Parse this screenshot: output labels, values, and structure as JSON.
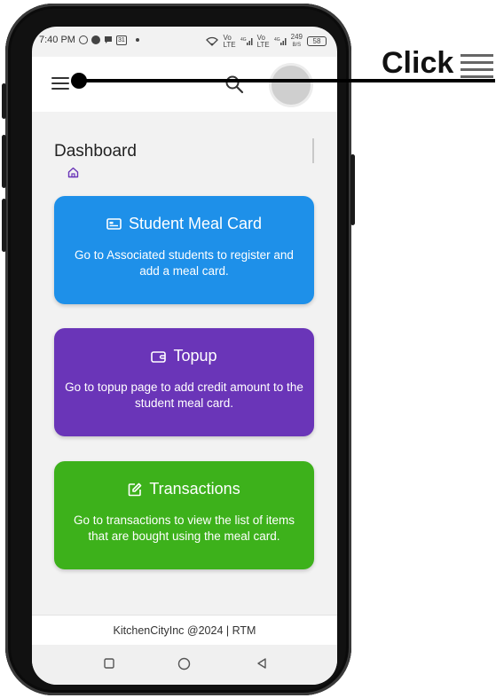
{
  "status_bar": {
    "time": "7:40 PM",
    "left_icons": [
      "whatsapp-icon",
      "chat-icon",
      "message-icon",
      "calendar-icon",
      "dot-icon"
    ],
    "calendar_day": "31",
    "right_icons": [
      "wifi-icon",
      "volte-icon",
      "signal-4g-icon",
      "volte-icon",
      "signal-4g-icon"
    ],
    "speed": "249",
    "speed_unit": "B/S",
    "battery": "58"
  },
  "app_bar": {
    "menu_icon": "hamburger-menu-icon",
    "search_icon": "search-icon",
    "avatar": "user-avatar"
  },
  "page": {
    "title": "Dashboard",
    "breadcrumb_icon": "home-icon"
  },
  "cards": [
    {
      "title": "Student Meal Card",
      "icon": "id-card-icon",
      "description": "Go to Associated students to register and add a meal card.",
      "color": "#1e90e9"
    },
    {
      "title": "Topup",
      "icon": "wallet-icon",
      "description": "Go to topup page to add credit amount to the student meal card.",
      "color": "#6a35b8"
    },
    {
      "title": "Transactions",
      "icon": "edit-icon",
      "description": "Go to transactions to view the list of items that are bought using the meal card.",
      "color": "#3db11b"
    }
  ],
  "footer": {
    "text": "KitchenCityInc @2024 | RTM"
  },
  "nav_bar": {
    "icons": [
      "recent-apps-icon",
      "home-button-icon",
      "back-icon"
    ]
  },
  "callout": {
    "label": "Click",
    "icon": "hamburger-menu-icon"
  }
}
